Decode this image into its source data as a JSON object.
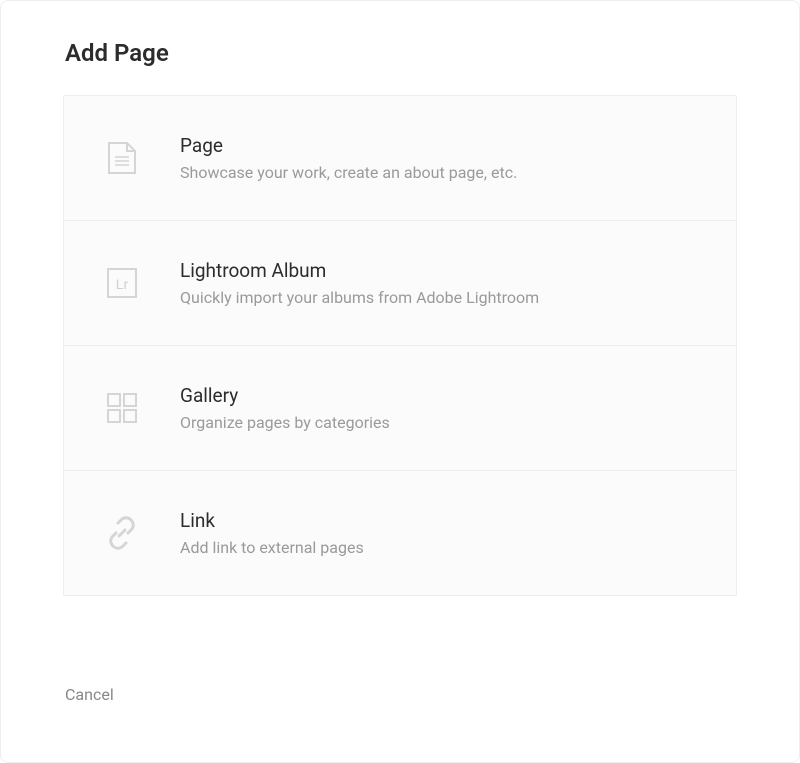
{
  "header": {
    "title": "Add Page"
  },
  "options": {
    "page": {
      "title": "Page",
      "description": "Showcase your work, create an about page, etc."
    },
    "lightroom": {
      "title": "Lightroom Album",
      "description": "Quickly import your albums from Adobe Lightroom",
      "icon_label": "Lr"
    },
    "gallery": {
      "title": "Gallery",
      "description": "Organize pages by categories"
    },
    "link": {
      "title": "Link",
      "description": "Add link to external pages"
    }
  },
  "footer": {
    "cancel_label": "Cancel"
  }
}
